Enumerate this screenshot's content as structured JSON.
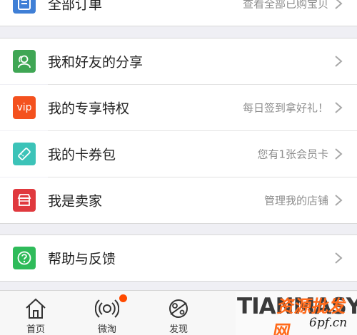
{
  "menu": {
    "orders": {
      "label": "全部订单",
      "sub": "查看全部已购宝贝",
      "icon": "order-list-icon"
    },
    "group1": [
      {
        "key": "share",
        "label": "我和好友的分享",
        "sub": "",
        "icon": "friends-share-icon",
        "color": "#3fa654"
      },
      {
        "key": "vip",
        "label": "我的专享特权",
        "sub": "每日签到拿好礼！",
        "icon": "vip-icon",
        "icon_text": "vip",
        "color": "#f4511e"
      },
      {
        "key": "coupon",
        "label": "我的卡券包",
        "sub": "您有1张会员卡",
        "icon": "coupon-ticket-icon",
        "color": "#3cc3b8"
      },
      {
        "key": "seller",
        "label": "我是卖家",
        "sub": "管理我的店铺",
        "icon": "store-icon",
        "color": "#e0393e"
      }
    ],
    "help": {
      "label": "帮助与反馈",
      "sub": "",
      "icon": "help-question-icon",
      "color": "#2fbb5a"
    }
  },
  "tabbar": {
    "tabs": [
      {
        "key": "home",
        "label": "首页",
        "icon": "home-icon"
      },
      {
        "key": "weitao",
        "label": "微淘",
        "icon": "broadcast-icon",
        "badge": true
      },
      {
        "key": "discover",
        "label": "发现",
        "icon": "planet-icon"
      }
    ]
  },
  "watermark": {
    "brand": "TIANMASY",
    "cn": "资源批发网",
    "url": "6pf.cn"
  },
  "colors": {
    "background": "#efeff4",
    "badge": "#ff4a00",
    "text": "#222222",
    "subtext": "#8e8e8e"
  }
}
